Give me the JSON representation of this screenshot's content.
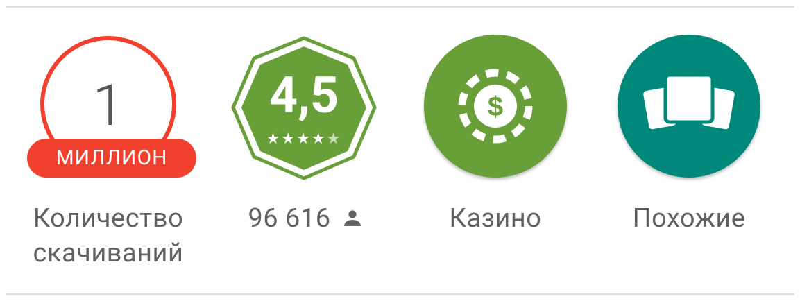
{
  "downloads": {
    "number": "1",
    "unit": "МИЛЛИОН",
    "label_line1": "Количество",
    "label_line2": "скачиваний",
    "color": "#f2402e"
  },
  "rating": {
    "value": "4,5",
    "stars": 4.5,
    "count": "96 616",
    "color": "#689f38",
    "icon": "person-icon"
  },
  "category": {
    "label": "Казино",
    "icon": "casino-chip-icon",
    "color": "#689f38"
  },
  "similar": {
    "label": "Похожие",
    "icon": "similar-apps-icon",
    "color": "#00897b"
  }
}
